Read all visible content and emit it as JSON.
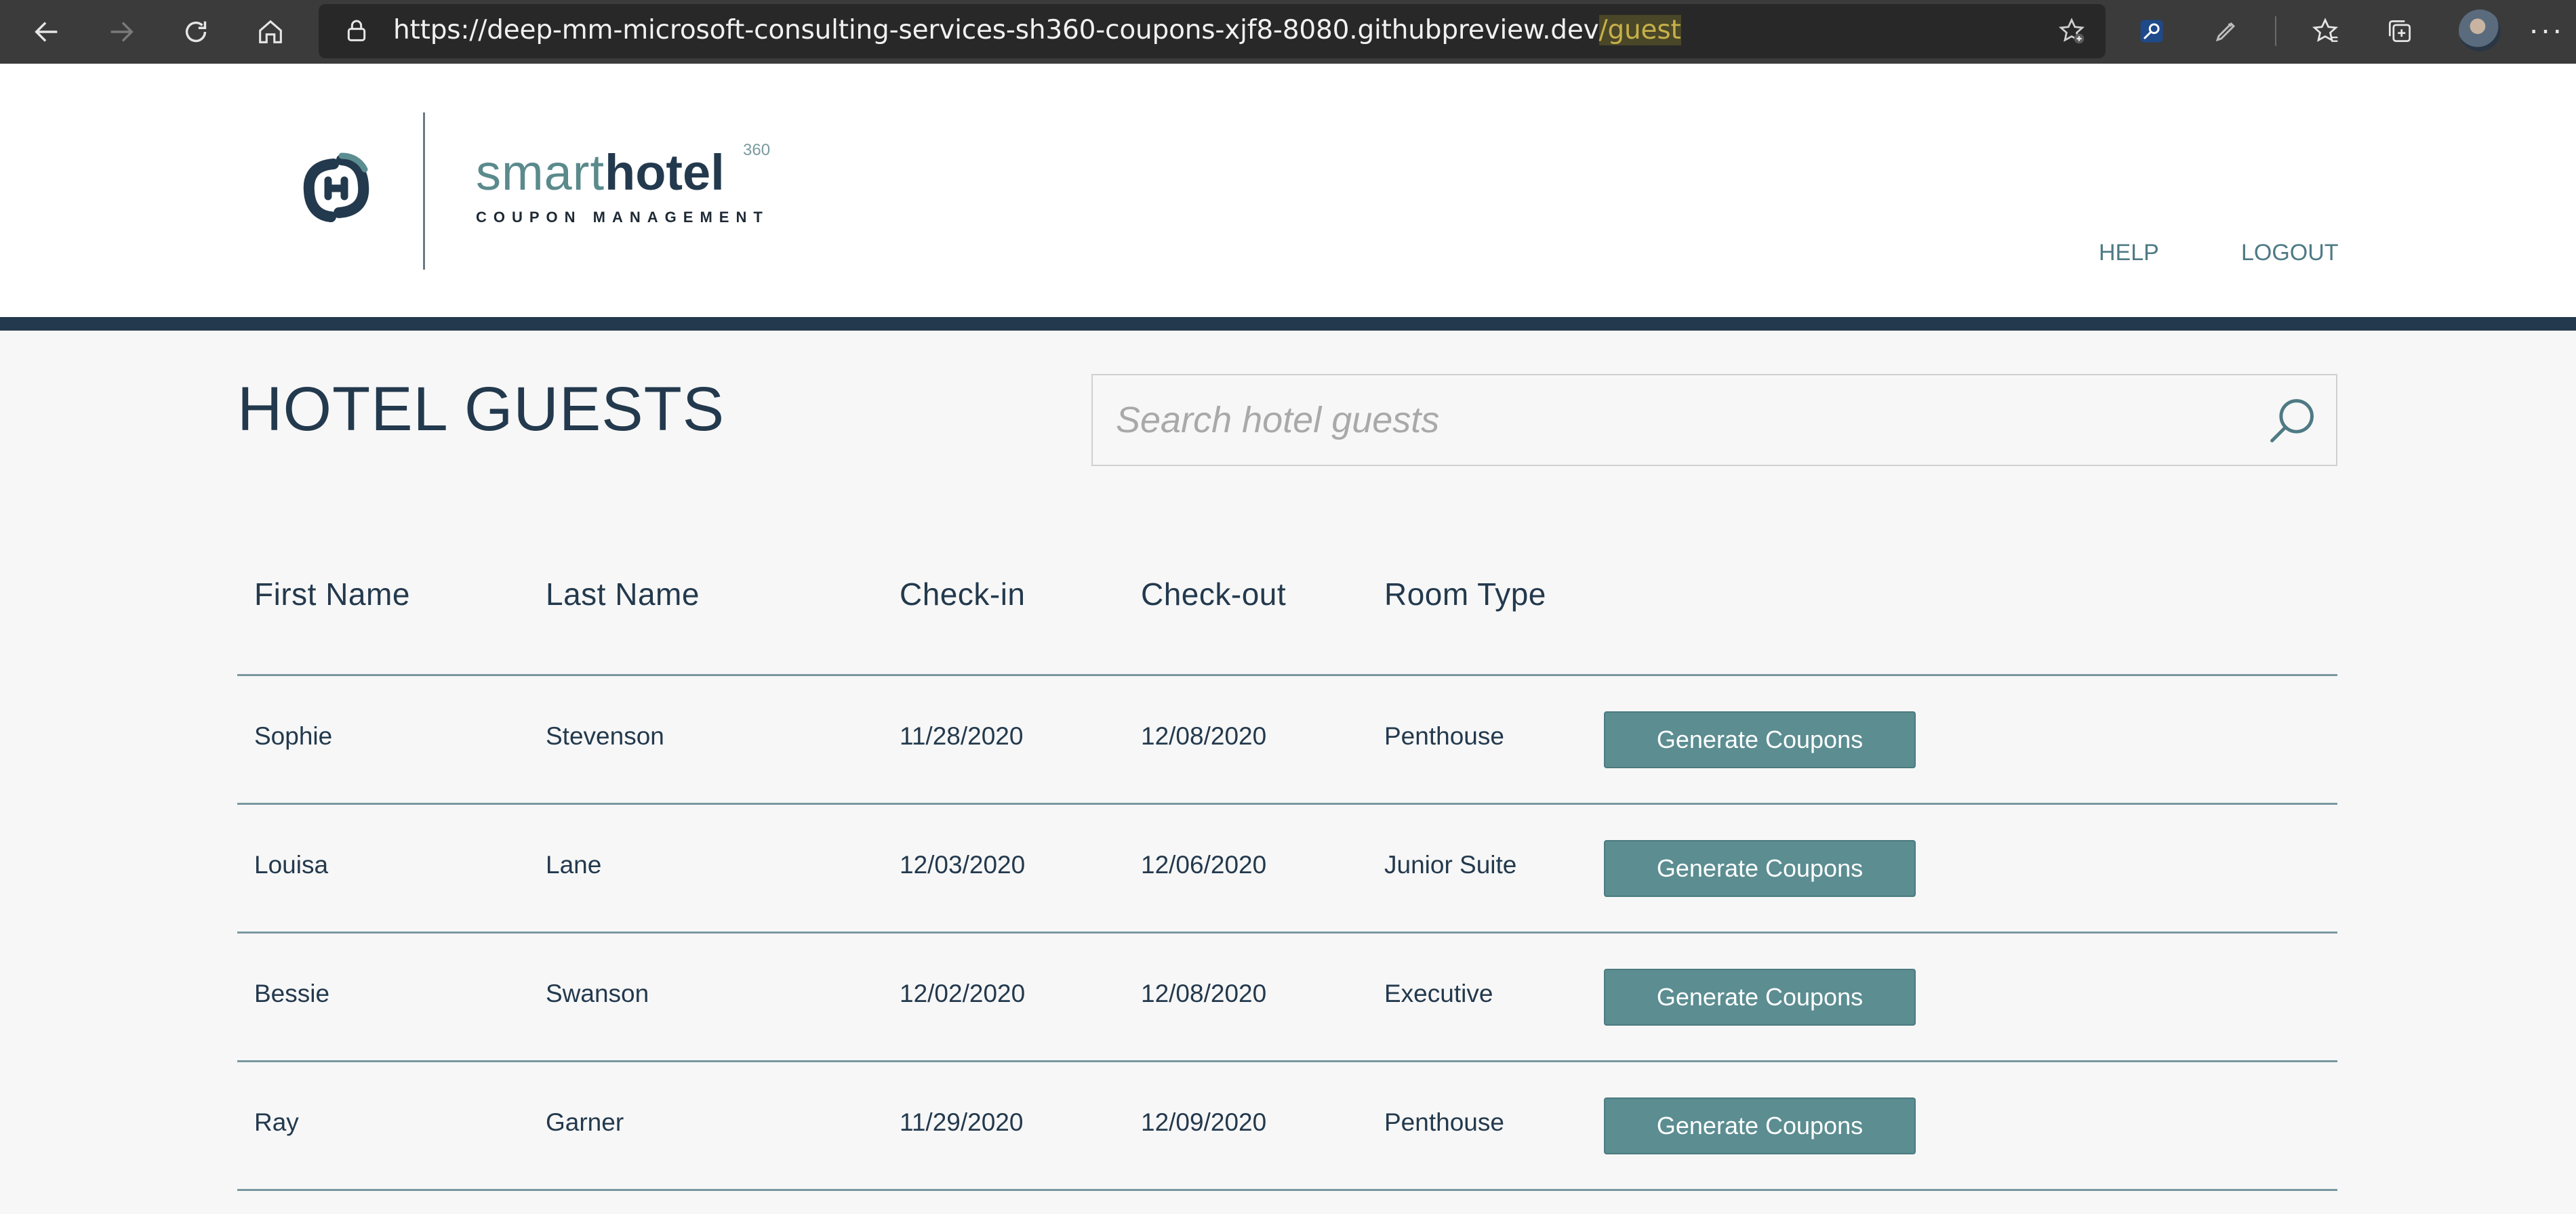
{
  "browser": {
    "url_base": "https://deep-mm-microsoft-consulting-services-sh360-coupons-xjf8-8080.githubpreview.dev",
    "url_path": "/guest"
  },
  "header": {
    "brand_smart": "smart",
    "brand_hotel": "hotel",
    "brand_sup": "360",
    "brand_sub": "COUPON MANAGEMENT",
    "nav": [
      {
        "label": "HELP"
      },
      {
        "label": "LOGOUT"
      }
    ]
  },
  "main": {
    "title": "HOTEL GUESTS",
    "search": {
      "placeholder": "Search hotel guests",
      "value": ""
    }
  },
  "table": {
    "columns": [
      "First Name",
      "Last Name",
      "Check-in",
      "Check-out",
      "Room Type"
    ],
    "action_label": "Generate Coupons",
    "rows": [
      {
        "first": "Sophie",
        "last": "Stevenson",
        "checkin": "11/28/2020",
        "checkout": "12/08/2020",
        "room": "Penthouse"
      },
      {
        "first": "Louisa",
        "last": "Lane",
        "checkin": "12/03/2020",
        "checkout": "12/06/2020",
        "room": "Junior Suite"
      },
      {
        "first": "Bessie",
        "last": "Swanson",
        "checkin": "12/02/2020",
        "checkout": "12/08/2020",
        "room": "Executive"
      },
      {
        "first": "Ray",
        "last": "Garner",
        "checkin": "11/29/2020",
        "checkout": "12/09/2020",
        "room": "Penthouse"
      }
    ]
  },
  "colors": {
    "primary_dark": "#23394d",
    "accent_teal": "#5b8d91",
    "page_bg": "#f7f7f7"
  }
}
